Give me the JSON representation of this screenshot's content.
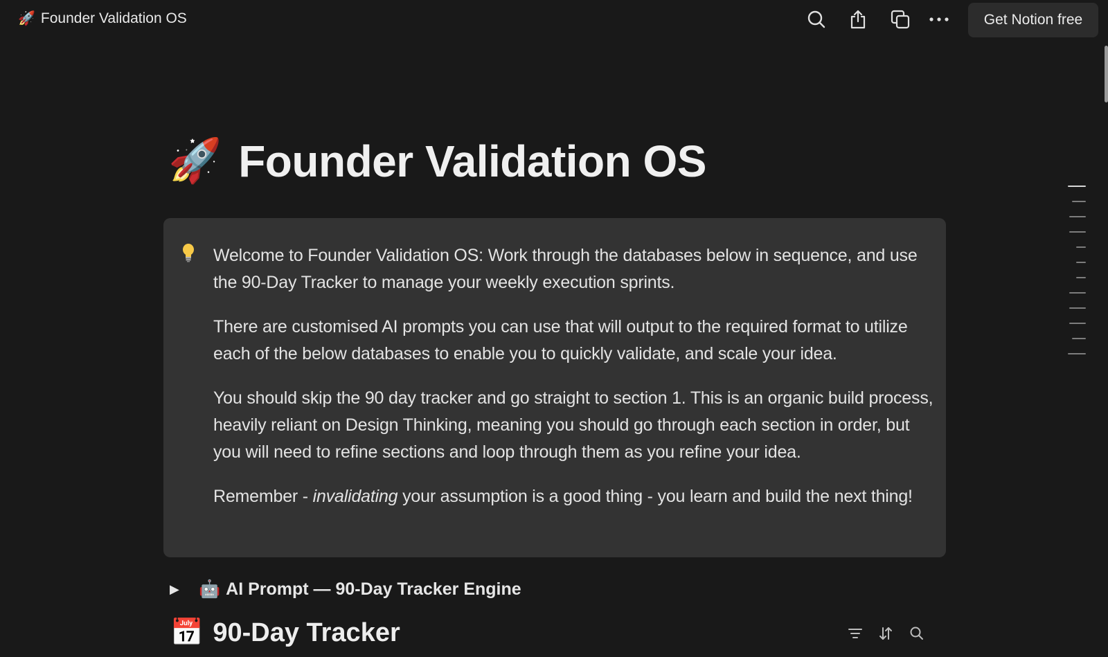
{
  "topbar": {
    "emoji": "🚀",
    "title": "Founder Validation OS",
    "icons": [
      "search-icon",
      "share-icon",
      "duplicate-icon",
      "more-icon"
    ],
    "cta_label": "Get Notion free"
  },
  "page": {
    "emoji": "🚀",
    "title": "Founder Validation OS"
  },
  "callout": {
    "icon": "lightbulb-icon",
    "p1": "Welcome to Founder Validation OS: Work through the databases below in sequence, and use the 90-Day Tracker to manage your weekly execution sprints.",
    "p2": "There are customised AI prompts you can use that will output to the required format to utilize each of the below databases to enable you to quickly validate, and scale your idea.",
    "p3": "You should skip the 90 day tracker and go straight to section 1. This is an organic build process, heavily reliant on Design Thinking, meaning you should go through each section in order, but you will need to refine sections and loop through them as you refine your idea.",
    "p4_prefix": "Remember - ",
    "p4_italic": "invalidating",
    "p4_suffix": " your assumption is a good thing - you learn and build the next thing!"
  },
  "toggle": {
    "arrow": "▶",
    "emoji": "🤖",
    "label": "AI Prompt — 90-Day Tracker Engine"
  },
  "database": {
    "emoji": "📅",
    "title": "90-Day Tracker",
    "icons": [
      "filter-icon",
      "sort-icon",
      "search-icon"
    ]
  }
}
